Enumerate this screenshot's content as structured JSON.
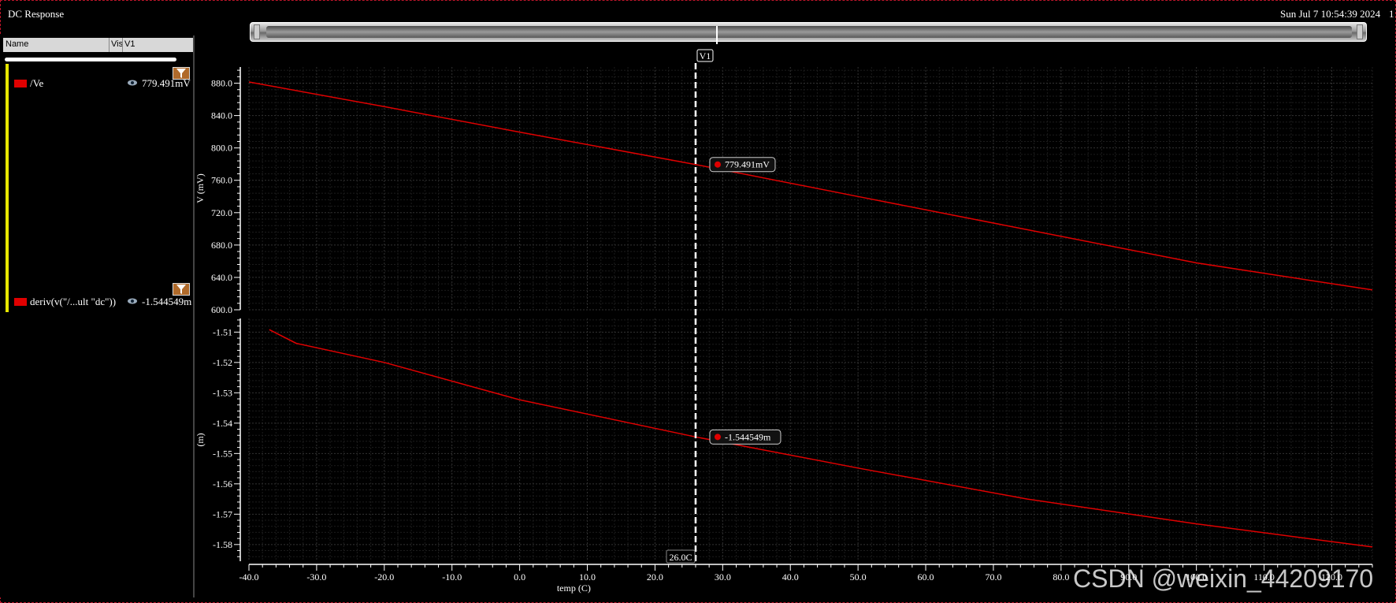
{
  "window": {
    "title": "DC Response",
    "datetime": "Sun Jul 7 10:54:39 2024",
    "datetime_extra": "1"
  },
  "columns": {
    "name": "Name",
    "vis": "Vis",
    "v1": "V1"
  },
  "signals": [
    {
      "name": "/Ve",
      "value": "779.491mV",
      "color": "#e00000"
    },
    {
      "name": "deriv(v(\"/...ult \"dc\"))",
      "value": "-1.544549m",
      "color": "#e00000"
    }
  ],
  "cursor": {
    "label": "V1",
    "x_label": "26.0C"
  },
  "watermark": "CSDN @weixin_44209170",
  "chart_data": [
    {
      "type": "line",
      "title": "",
      "xlabel": "temp (C)",
      "ylabel": "V (mV)",
      "xlim": [
        -40,
        126
      ],
      "ylim": [
        600,
        900
      ],
      "x_ticks": [
        -40,
        -30,
        -20,
        -10,
        0,
        10,
        20,
        30,
        40,
        50,
        60,
        70,
        80,
        90,
        100,
        110,
        120
      ],
      "x_tick_labels": [
        "-40.0",
        "-30.0",
        "-20.0",
        "-10.0",
        "0.0",
        "10.0",
        "20.0",
        "30.0",
        "40.0",
        "50.0",
        "60.0",
        "70.0",
        "80.0",
        "90.0",
        "100.0",
        "110.0",
        "120.0"
      ],
      "y_ticks": [
        600,
        640,
        680,
        720,
        760,
        800,
        840,
        880
      ],
      "y_tick_labels": [
        "600.0",
        "640.0",
        "680.0",
        "720.0",
        "760.0",
        "800.0",
        "840.0",
        "880.0"
      ],
      "grid": true,
      "series": [
        {
          "name": "/Ve",
          "color": "#e00000",
          "x": [
            -40,
            -20,
            0,
            26,
            50,
            75,
            100,
            126
          ],
          "y": [
            881.5,
            851.0,
            819.5,
            779.491,
            740.0,
            699.0,
            658.0,
            624.5
          ]
        }
      ],
      "marker": {
        "x": 26,
        "y": 779.491,
        "label": "779.491mV"
      }
    },
    {
      "type": "line",
      "title": "",
      "xlabel": "temp (C)",
      "ylabel": "(m)",
      "xlim": [
        -40,
        126
      ],
      "ylim": [
        -1.5855,
        -1.5055
      ],
      "x_ticks": [
        -40,
        -30,
        -20,
        -10,
        0,
        10,
        20,
        30,
        40,
        50,
        60,
        70,
        80,
        90,
        100,
        110,
        120
      ],
      "x_tick_labels": [
        "-40.0",
        "-30.0",
        "-20.0",
        "-10.0",
        "0.0",
        "10.0",
        "20.0",
        "30.0",
        "40.0",
        "50.0",
        "60.0",
        "70.0",
        "80.0",
        "90.0",
        "100.0",
        "110.0",
        "120.0"
      ],
      "y_ticks": [
        -1.51,
        -1.52,
        -1.53,
        -1.54,
        -1.55,
        -1.56,
        -1.57,
        -1.58
      ],
      "y_tick_labels": [
        "-1.51",
        "-1.52",
        "-1.53",
        "-1.54",
        "-1.55",
        "-1.56",
        "-1.57",
        "-1.58"
      ],
      "grid": true,
      "series": [
        {
          "name": "deriv(v(\"/...ult \"dc\"))",
          "color": "#e00000",
          "x": [
            -37,
            -33,
            -20,
            0,
            26,
            50,
            75,
            100,
            126
          ],
          "y": [
            -1.5092,
            -1.5137,
            -1.52,
            -1.5323,
            -1.544549,
            -1.5548,
            -1.565,
            -1.5732,
            -1.5808
          ]
        }
      ],
      "marker": {
        "x": 26,
        "y": -1.544549,
        "label": "-1.544549m"
      }
    }
  ]
}
